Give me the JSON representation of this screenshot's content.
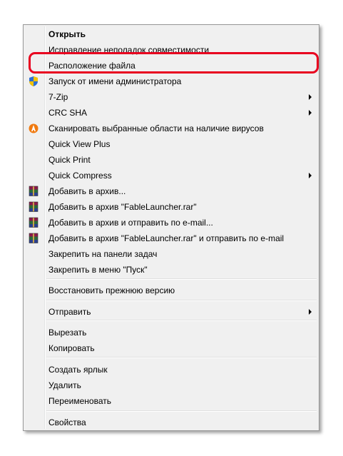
{
  "context_menu": {
    "items": [
      {
        "label": "Открыть",
        "bold": true,
        "icon": "",
        "submenu": false
      },
      {
        "label": "Исправление неполадок совместимости",
        "bold": false,
        "icon": "",
        "submenu": false
      },
      {
        "label": "Расположение файла",
        "bold": false,
        "icon": "",
        "submenu": false
      },
      {
        "label": "Запуск от имени администратора",
        "bold": false,
        "icon": "shield-icon",
        "submenu": false
      },
      {
        "label": "7-Zip",
        "bold": false,
        "icon": "",
        "submenu": true
      },
      {
        "label": "CRC SHA",
        "bold": false,
        "icon": "",
        "submenu": true
      },
      {
        "label": "Сканировать выбранные области на наличие вирусов",
        "bold": false,
        "icon": "avast-icon",
        "submenu": false
      },
      {
        "label": "Quick View Plus",
        "bold": false,
        "icon": "",
        "submenu": false
      },
      {
        "label": "Quick Print",
        "bold": false,
        "icon": "",
        "submenu": false
      },
      {
        "label": "Quick Compress",
        "bold": false,
        "icon": "",
        "submenu": true
      },
      {
        "label": "Добавить в архив...",
        "bold": false,
        "icon": "winrar-icon",
        "submenu": false
      },
      {
        "label": "Добавить в архив \"FableLauncher.rar\"",
        "bold": false,
        "icon": "winrar-icon",
        "submenu": false
      },
      {
        "label": "Добавить в архив и отправить по e-mail...",
        "bold": false,
        "icon": "winrar-icon",
        "submenu": false
      },
      {
        "label": "Добавить в архив \"FableLauncher.rar\" и отправить по e-mail",
        "bold": false,
        "icon": "winrar-icon",
        "submenu": false
      },
      {
        "label": "Закрепить на панели задач",
        "bold": false,
        "icon": "",
        "submenu": false
      },
      {
        "label": "Закрепить в меню \"Пуск\"",
        "bold": false,
        "icon": "",
        "submenu": false
      },
      {
        "label": "Восстановить прежнюю версию",
        "bold": false,
        "icon": "",
        "submenu": false
      },
      {
        "label": "Отправить",
        "bold": false,
        "icon": "",
        "submenu": true
      },
      {
        "label": "Вырезать",
        "bold": false,
        "icon": "",
        "submenu": false
      },
      {
        "label": "Копировать",
        "bold": false,
        "icon": "",
        "submenu": false
      },
      {
        "label": "Создать ярлык",
        "bold": false,
        "icon": "",
        "submenu": false
      },
      {
        "label": "Удалить",
        "bold": false,
        "icon": "",
        "submenu": false
      },
      {
        "label": "Переименовать",
        "bold": false,
        "icon": "",
        "submenu": false
      },
      {
        "label": "Свойства",
        "bold": false,
        "icon": "",
        "submenu": false
      }
    ],
    "highlighted_index": 2,
    "colors": {
      "highlight_border": "#e8001f",
      "menu_background": "#f0f0f0"
    }
  }
}
